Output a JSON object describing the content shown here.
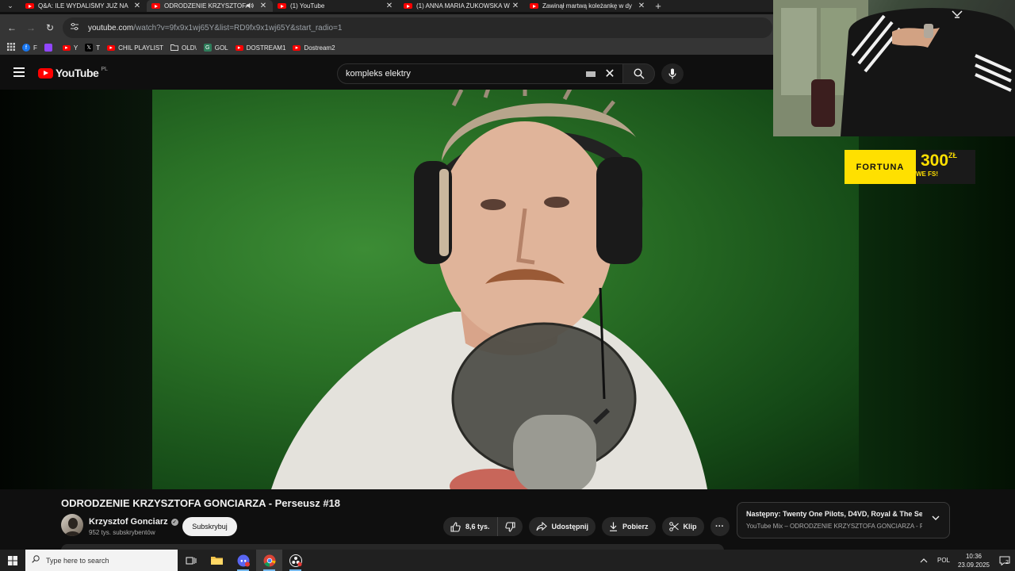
{
  "browser": {
    "tabs": [
      {
        "title": "Q&A: ILE WYDALIŚMY JUŻ NA",
        "active": false,
        "audible": false
      },
      {
        "title": "ODRODZENIE KRZYSZTOFA",
        "active": true,
        "audible": true
      },
      {
        "title": "(1) YouTube",
        "active": false,
        "audible": false
      },
      {
        "title": "(1) ANNA MARIA ŻUKOWSKA W",
        "active": false,
        "audible": false
      },
      {
        "title": "Zawinął martwą koleżankę w dy",
        "active": false,
        "audible": false
      }
    ],
    "tab_close_glyph": "✕",
    "new_tab_glyph": "+",
    "url_host": "youtube.com",
    "url_rest": "/watch?v=9fx9x1wj65Y&list=RD9fx9x1wj65Y&start_radio=1",
    "bookmarks": [
      {
        "label": "F",
        "icon": "facebook-icon",
        "color": "#1877f2"
      },
      {
        "label": "",
        "icon": "twitch-icon",
        "color": "#9146ff"
      },
      {
        "label": "Y",
        "icon": "youtube-icon",
        "color": "#ff0000"
      },
      {
        "label": "T",
        "icon": "x-icon",
        "color": "#000000"
      },
      {
        "label": "CHIL PLAYLIST",
        "icon": "youtube-icon",
        "color": "#ff0000"
      },
      {
        "label": "OLD\\",
        "icon": "folder-icon",
        "color": "#353535"
      },
      {
        "label": "GOL",
        "icon": "g-icon",
        "color": "#2e7d5b"
      },
      {
        "label": "DOSTREAM1",
        "icon": "youtube-icon",
        "color": "#ff0000"
      },
      {
        "label": "Dostream2",
        "icon": "youtube-icon",
        "color": "#ff0000"
      }
    ]
  },
  "youtube": {
    "logo_text": "YouTube",
    "region": "PL",
    "search_value": "kompleks elektry",
    "accent": "#ff0000"
  },
  "overlay": {
    "sponsor_brand": "FORTUNA",
    "sponsor_amount": "300",
    "sponsor_currency": "ZŁ",
    "sponsor_sub": "WE FS!"
  },
  "video": {
    "title": "ODRODZENIE KRZYSZTOFA GONCIARZA - Perseusz #18",
    "channel": "Krzysztof Gonciarz",
    "subscribers": "952 tys. subskrybentów",
    "subscribe_label": "Subskrybuj",
    "likes": "8,6 tys.",
    "share_label": "Udostępnij",
    "download_label": "Pobierz",
    "clip_label": "Klip",
    "more_label": "···"
  },
  "next_up": {
    "title": "Następny: Twenty One Pilots, D4VD, Royal & The Se...",
    "subtitle": "YouTube Mix – ODRODZENIE KRZYSZTOFA GONCIARZA - P..."
  },
  "taskbar": {
    "search_placeholder": "Type here to search",
    "language": "POL",
    "time": "10:36",
    "date": "23.09.2025",
    "notifications": "2"
  }
}
